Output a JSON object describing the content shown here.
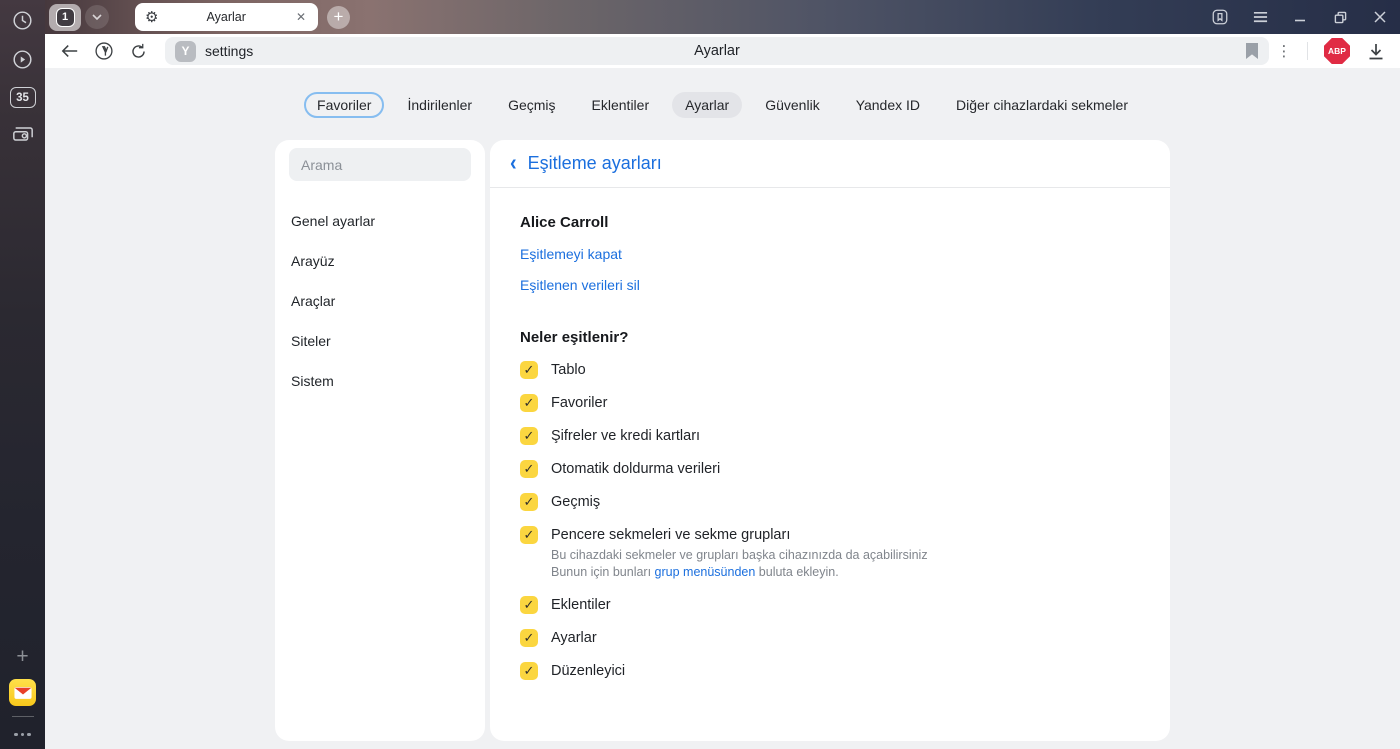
{
  "browser": {
    "rail": {
      "badge_count": "35",
      "icons": [
        "history-clock",
        "media-play",
        "tab-counter",
        "screencast",
        "add",
        "yandex-mail",
        "more-dots"
      ]
    },
    "tab_strip": {
      "group_count": "1",
      "tab_title": "Ayarlar",
      "new_tab_label": "+"
    },
    "address_bar": {
      "url": "settings",
      "page_title": "Ayarlar",
      "abp_label": "ABP"
    }
  },
  "nav": {
    "items": [
      {
        "label": "Favoriler"
      },
      {
        "label": "İndirilenler"
      },
      {
        "label": "Geçmiş"
      },
      {
        "label": "Eklentiler"
      },
      {
        "label": "Ayarlar"
      },
      {
        "label": "Güvenlik"
      },
      {
        "label": "Yandex ID"
      },
      {
        "label": "Diğer cihazlardaki sekmeler"
      }
    ],
    "active": "Ayarlar",
    "focused": "Favoriler"
  },
  "settings_menu": {
    "search_placeholder": "Arama",
    "items": [
      {
        "label": "Genel ayarlar"
      },
      {
        "label": "Arayüz"
      },
      {
        "label": "Araçlar"
      },
      {
        "label": "Siteler"
      },
      {
        "label": "Sistem"
      }
    ]
  },
  "sync": {
    "title": "Eşitleme ayarları",
    "account_name": "Alice Carroll",
    "link_turn_off": "Eşitlemeyi kapat",
    "link_delete_data": "Eşitlenen verileri sil",
    "section_title": "Neler eşitlenir?",
    "check_glyph": "✓",
    "items": [
      {
        "label": "Tablo",
        "checked": true
      },
      {
        "label": "Favoriler",
        "checked": true
      },
      {
        "label": "Şifreler ve kredi kartları",
        "checked": true
      },
      {
        "label": "Otomatik doldurma verileri",
        "checked": true
      },
      {
        "label": "Geçmiş",
        "checked": true
      },
      {
        "label": "Pencere sekmeleri ve sekme grupları",
        "checked": true
      },
      {
        "label": "Eklentiler",
        "checked": true
      },
      {
        "label": "Ayarlar",
        "checked": true
      },
      {
        "label": "Düzenleyici",
        "checked": true
      }
    ],
    "tabs_desc_line1": "Bu cihazdaki sekmeler ve grupları başka cihazınızda da açabilirsiniz",
    "tabs_desc_line2_prefix": "Bunun için bunları ",
    "tabs_desc_line2_link": "grup menüsünden",
    "tabs_desc_line2_suffix": " buluta ekleyin."
  },
  "colors": {
    "accent_blue": "#1b6fde",
    "checkbox_yellow": "#fbd640",
    "abp_red": "#e02b44",
    "page_bg": "#f0f1f3",
    "active_pill": "#e3e4e8"
  }
}
